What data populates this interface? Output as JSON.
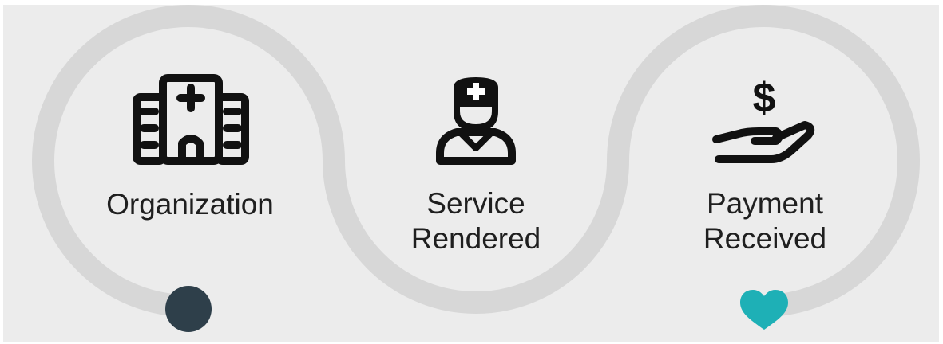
{
  "steps": [
    {
      "icon": "hospital-building-icon",
      "line1": "Organization",
      "line2": ""
    },
    {
      "icon": "nurse-icon",
      "line1": "Service",
      "line2": "Rendered"
    },
    {
      "icon": "hand-holding-dollar-icon",
      "line1": "Payment",
      "line2": "Received"
    }
  ],
  "markers": {
    "start": {
      "icon": "start-dot-icon",
      "color": "#2e3f4a"
    },
    "end": {
      "icon": "heart-icon",
      "color": "#1eb0b6"
    }
  },
  "colors": {
    "background": "#ececec",
    "path": "#d7d7d7",
    "icon": "#111111",
    "text": "#1f1f1f"
  }
}
